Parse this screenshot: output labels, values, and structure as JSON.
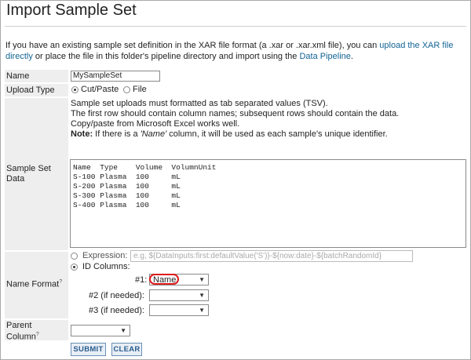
{
  "page": {
    "title": "Import Sample Set",
    "intro_text_1": "If you have an existing sample set definition in the XAR file format (a .xar or .xar.xml file), you can ",
    "intro_link_1": "upload the XAR file directly",
    "intro_text_2": " or place the file in this folder's pipeline directory and import using the ",
    "intro_link_2": "Data Pipeline",
    "intro_text_3": "."
  },
  "form": {
    "name": {
      "label": "Name",
      "value": "MySampleSet"
    },
    "upload_type": {
      "label": "Upload Type",
      "option_paste": "Cut/Paste",
      "option_file": "File",
      "selected": "Cut/Paste"
    },
    "sample_data": {
      "label": "Sample Set Data",
      "desc_line1": "Sample set uploads must formatted as tab separated values (TSV).",
      "desc_line2": "The first row should contain column names; subsequent rows should contain the data.",
      "desc_line3": "Copy/paste from Microsoft Excel works well.",
      "note_label": "Note:",
      "note_text_a": " If there is a ",
      "note_name": "'Name'",
      "note_text_b": " column, it will be used as each sample's unique identifier.",
      "rows": [
        "Name  Type    Volume  VolumnUnit",
        "S-100 Plasma  100     mL",
        "S-200 Plasma  100     mL",
        "S-300 Plasma  100     mL",
        "S-400 Plasma  100     mL"
      ]
    },
    "name_format": {
      "label": "Name Format",
      "help": "?",
      "expression_label": "Expression:",
      "expression_placeholder": "e.g, ${DataInputs:first:defaultValue('S')}-${now:date}-${batchRandomId}",
      "id_columns_label": "ID Columns:",
      "selected": "ID Columns",
      "col1_label": "#1:",
      "col1_value": "Name",
      "col2_label": "#2 (if needed):",
      "col2_value": "",
      "col3_label": "#3 (if needed):",
      "col3_value": ""
    },
    "parent_column": {
      "label_1": "Parent",
      "label_2": "Column",
      "help": "?",
      "value": ""
    },
    "buttons": {
      "submit": "SUBMIT",
      "clear": "CLEAR"
    }
  },
  "colors": {
    "link": "#126495",
    "label_bg": "#eeeeee",
    "highlight_circle": "#e01b1b",
    "button_text": "#2a5d8f"
  }
}
